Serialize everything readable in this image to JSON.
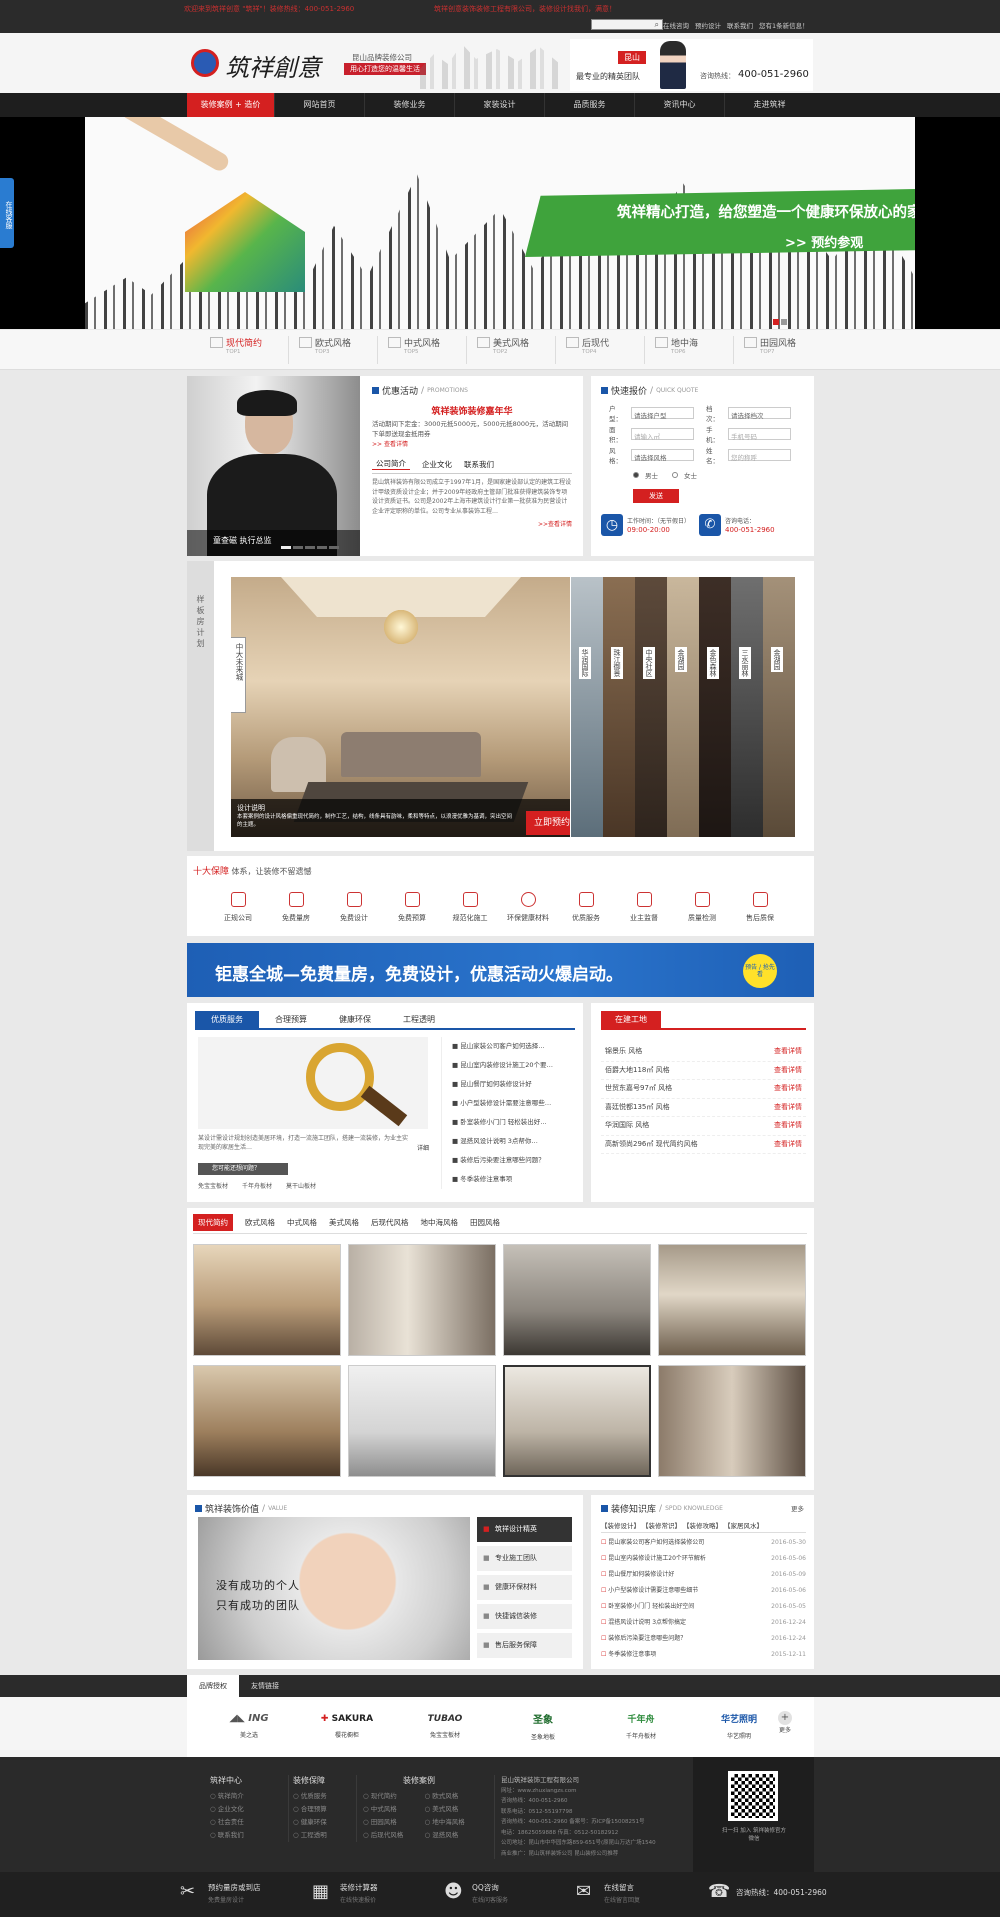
{
  "topbar": {
    "notice_left": "欢迎来到筑祥创意 \"筑祥\"！装修热线：400-051-2960",
    "notice_mid": "筑祥创意装饰装修工程有限公司，装修设计找我们，满意！",
    "search_placeholder": "",
    "links": [
      "在线咨询",
      "预约设计",
      "联系我们",
      "您有1条新信息！"
    ]
  },
  "header": {
    "logo_text": "筑祥創意",
    "company_name": "昆山品牌装修公司",
    "slogan": "用心打造您的温馨生活",
    "city": "昆山",
    "team_text": "最专业的精英团队",
    "hotline_label": "咨询热线：",
    "hotline": "400-051-2960"
  },
  "nav": {
    "items": [
      "装修案例 + 造价",
      "网站首页",
      "装修业务",
      "家装设计",
      "品质服务",
      "资讯中心",
      "走进筑祥"
    ]
  },
  "side_float": {
    "label": "在线客服"
  },
  "banner": {
    "headline": "筑祥精心打造，给您塑造一个健康环保放心的家",
    "cta": ">> 预约参观"
  },
  "styles_bar": {
    "items": [
      {
        "name": "现代简约",
        "sub": "TOP1"
      },
      {
        "name": "欧式风格",
        "sub": "TOP3"
      },
      {
        "name": "中式风格",
        "sub": "TOP5"
      },
      {
        "name": "美式风格",
        "sub": "TOP2"
      },
      {
        "name": "后现代",
        "sub": "TOP4"
      },
      {
        "name": "地中海",
        "sub": "TOP6"
      },
      {
        "name": "田园风格",
        "sub": "TOP7"
      }
    ]
  },
  "promo": {
    "person_caption": "童查磁 执行总监",
    "title": "优惠活动",
    "title_en": "PROMOTIONS",
    "headline": "筑祥装饰装修嘉年华",
    "text": "活动期间下定金：3000元抵5000元，5000元抵8000元，活动期间下单即送现金抵用券",
    "more": ">> 查看详情",
    "tabs": [
      "公司简介",
      "企业文化",
      "联系我们"
    ],
    "intro": "昆山筑祥装饰有限公司成立于1997年1月，是国家建设部认定的建筑工程设计甲级资质设计企业；并于2009年经政府主管部门批准获得建筑装饰专项设计资质证书。公司是2002年上海市建筑设计行业第一批获准为民营设计企业评定职称的单位。公司专业从事装饰工程…",
    "intro_more": ">>查看详情"
  },
  "quote": {
    "title": "快速报价",
    "title_en": "QUICK QUOTE",
    "labels": [
      "户型：",
      "档次：",
      "面积：",
      "手机：",
      "风格：",
      "姓名："
    ],
    "values": [
      "请选择户型",
      "请选择档次",
      "请输入㎡",
      "手机号码",
      "请选择风格",
      "您的称呼"
    ],
    "genders": [
      "男士",
      "女士"
    ],
    "submit": "发送",
    "worktime_label": "工作时间：（无节假日）",
    "worktime": "09:00-20:00",
    "phone_label": "咨询电话：",
    "phone": "400-051-2960"
  },
  "model_plan": {
    "side_title": "样板房计划",
    "main_label": "中大未来城",
    "items": [
      "华润国际",
      "珠江御景",
      "中央社区",
      "金湖园",
      "金色森林",
      "三水丽林",
      "金湖园"
    ],
    "desc_title": "设计说明",
    "desc": "本套案例的设计风格偏重现代简约，制作工艺，结构，线条具有韵味，柔和等特点，以浪漫优雅为基调，突出空间的主题。",
    "cta": "立即预约"
  },
  "guarantee": {
    "title_red": "十大保障",
    "title_rest": " 体系，让装修不留遗憾",
    "items": [
      "正规公司",
      "免费量房",
      "免费设计",
      "免费预算",
      "规范化施工",
      "环保健康材料",
      "优质服务",
      "业主监督",
      "质量检测",
      "售后质保"
    ]
  },
  "promo_banner": {
    "text": "钜惠全城—免费量房，免费设计，优惠活动火爆启动。",
    "badge": "预告 / 抢先看"
  },
  "service": {
    "tabs": [
      "优质服务",
      "合理预算",
      "健康环保",
      "工程透明"
    ],
    "text": "某设计需设计规划创造美居环境，打造一流施工团队，搭建一流装修，为业主实现完美的家居生活…",
    "more": "详细",
    "btn": "您可能还想问题？",
    "tags": [
      "免宝宝板材",
      "千年舟板材",
      "莫干山板材"
    ],
    "news": [
      "昆山家装公司客户如何选择…",
      "昆山室内装修设计施工20个要…",
      "昆山餐厅如何装修设计好",
      "小户型装修设计需要注意哪些…",
      "卧室装修小门门 轻松装出好…",
      "混搭风设计说明 3点帮你…",
      "装修后污染要注意哪些问题？",
      "冬季装修注意事项"
    ]
  },
  "sites": {
    "title": "在建工地",
    "items": [
      {
        "name": "锦景乐 风格",
        "more": "查看详情"
      },
      {
        "name": "佰爵大地118㎡ 风格",
        "more": "查看详情"
      },
      {
        "name": "世贸东嘉号97㎡ 风格",
        "more": "查看详情"
      },
      {
        "name": "喜廷悦都135㎡ 风格",
        "more": "查看详情"
      },
      {
        "name": "华润国际 风格",
        "more": "查看详情"
      },
      {
        "name": "高新领尚296㎡ 现代简约风格",
        "more": "查看详情"
      }
    ]
  },
  "cases": {
    "tabs": [
      "现代简约",
      "欧式风格",
      "中式风格",
      "美式风格",
      "后现代风格",
      "地中海风格",
      "田园风格"
    ]
  },
  "value": {
    "title": "筑祥装饰价值",
    "title_en": "VALUE",
    "image_text": [
      "没有成功的个人",
      "只有成功的团队"
    ],
    "items": [
      "筑祥设计精英",
      "专业施工团队",
      "健康环保材料",
      "快捷诚信装修",
      "售后服务保障"
    ]
  },
  "knowledge": {
    "title": "装修知识库",
    "title_en": "SPDD KNOWLEDGE",
    "more": "更多",
    "tabs": [
      "【装修设计】",
      "【装修常识】",
      "【装修攻略】",
      "【家居风水】"
    ],
    "items": [
      {
        "t": "昆山家装公司客户如何选择装修公司",
        "d": "2016-05-30"
      },
      {
        "t": "昆山室内装修设计施工20个环节解析",
        "d": "2016-05-06"
      },
      {
        "t": "昆山餐厅如何装修设计好",
        "d": "2016-05-09"
      },
      {
        "t": "小户型装修设计需要注意哪些细节",
        "d": "2016-05-06"
      },
      {
        "t": "卧室装修小门门 轻松装出好空间",
        "d": "2016-05-05"
      },
      {
        "t": "混搭风设计说明 3点帮你搞定",
        "d": "2016-12-24"
      },
      {
        "t": "装修后污染要注意哪些问题？",
        "d": "2016-12-24"
      },
      {
        "t": "冬季装修注意事项",
        "d": "2015-12-11"
      }
    ]
  },
  "partners": {
    "tabs": [
      "品牌授权",
      "友情链接"
    ],
    "items": [
      "美之选",
      "樱花橱柜",
      "兔宝宝板材",
      "圣象地板",
      "千年舟板材",
      "华艺照明"
    ],
    "more": "更多"
  },
  "footer": {
    "cols": [
      {
        "title": "筑祥中心",
        "items": [
          "筑祥简介",
          "企业文化",
          "社会责任",
          "联系我们"
        ]
      },
      {
        "title": "装修保障",
        "items": [
          "优质服务",
          "合理预算",
          "健康环保",
          "工程透明"
        ]
      },
      {
        "title": "装修案例",
        "items": [
          "现代简约",
          "中式风格",
          "田园风格",
          "后现代风格",
          "欧式风格",
          "美式风格",
          "地中海风格",
          "混搭风格"
        ]
      }
    ],
    "company": "昆山筑祥装饰工程有限公司",
    "info": [
      "网址：www.zhuxiangzs.com",
      "咨询热线：400-051-2960",
      "联系电话：0512-55197798",
      "咨询热线：400-051-2960  备案号：苏ICP备15008251号",
      "电话：18625059888  传真：0512-50182912",
      "公司地址：昆山市中华园东路859-651号(原昆山万达广场1540",
      "商业推广：昆山筑祥装饰公司  昆山装修公司推荐"
    ],
    "qr_caption": "扫一扫 加入 筑祥装修官方微信"
  },
  "bottom_bar": {
    "items": [
      {
        "t": "预约量房或到店",
        "s": "免费量房设计"
      },
      {
        "t": "装修计算器",
        "s": "在线快速报价"
      },
      {
        "t": "QQ咨询",
        "s": "在线问客服务"
      },
      {
        "t": "在线留言",
        "s": "在线留言回复"
      },
      {
        "t": "咨询热线：400-051-2960",
        "s": ""
      }
    ]
  }
}
